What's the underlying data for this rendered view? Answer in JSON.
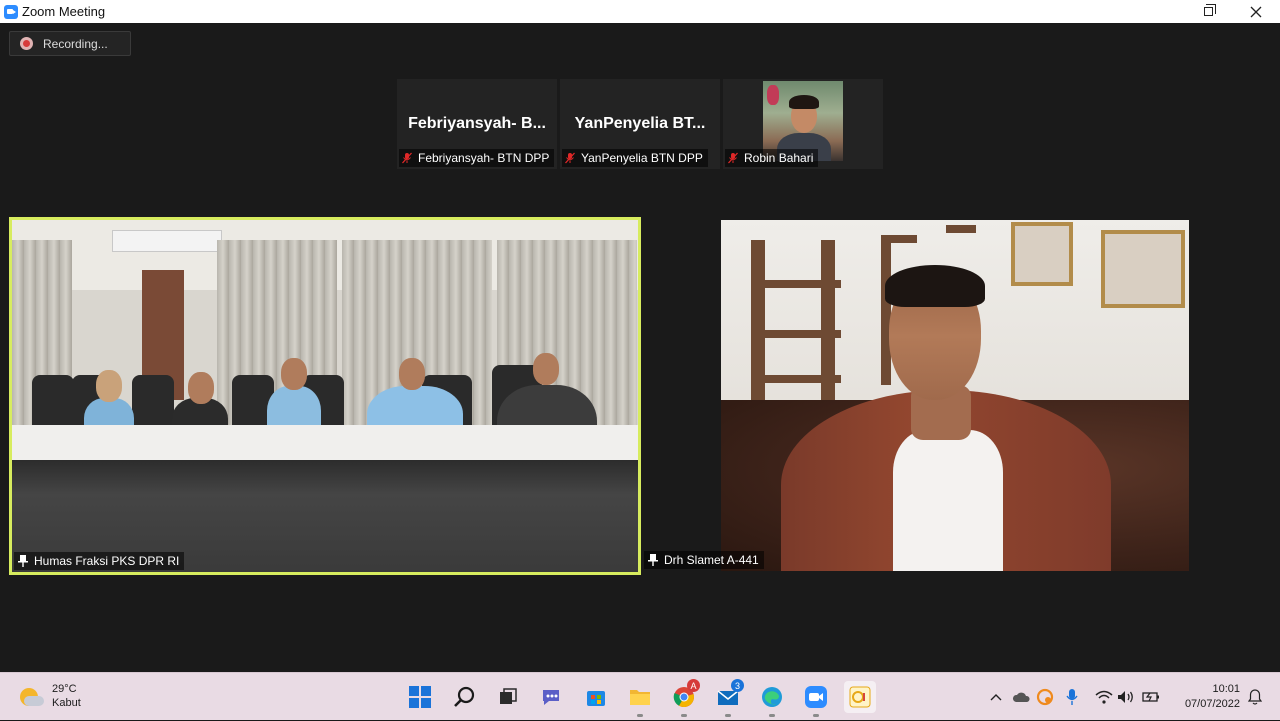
{
  "window": {
    "title": "Zoom Meeting"
  },
  "recording": {
    "label": "Recording..."
  },
  "thumbnails": [
    {
      "display_name": "Febriyansyah-  B...",
      "name_tag": "Febriyansyah- BTN DPP",
      "muted": true,
      "has_video": false
    },
    {
      "display_name": "YanPenyelia  BT...",
      "name_tag": "YanPenyelia BTN DPP",
      "muted": true,
      "has_video": false
    },
    {
      "display_name": "",
      "name_tag": "Robin Bahari",
      "muted": true,
      "has_video": true
    }
  ],
  "main_videos": [
    {
      "name_tag": "Humas Fraksi PKS DPR RI",
      "active_speaker": true
    },
    {
      "name_tag": "Drh Slamet A-441",
      "active_speaker": false
    }
  ],
  "taskbar": {
    "weather": {
      "temp": "29°C",
      "condition": "Kabut"
    },
    "apps": [
      {
        "name": "start",
        "icon": "windows-icon"
      },
      {
        "name": "search",
        "icon": "search-icon"
      },
      {
        "name": "task-view",
        "icon": "task-view-icon"
      },
      {
        "name": "chat",
        "icon": "chat-icon"
      },
      {
        "name": "store",
        "icon": "store-icon"
      },
      {
        "name": "file-explorer",
        "icon": "folder-icon"
      },
      {
        "name": "chrome",
        "icon": "chrome-icon",
        "badge": "A"
      },
      {
        "name": "mail",
        "icon": "mail-icon",
        "badge": "3"
      },
      {
        "name": "edge",
        "icon": "edge-icon"
      },
      {
        "name": "zoom",
        "icon": "zoom-icon"
      },
      {
        "name": "app",
        "icon": "app-icon"
      }
    ],
    "clock": {
      "time": "10:01",
      "date": "07/07/2022"
    }
  },
  "colors": {
    "active_speaker_border": "#d7ec5e",
    "zoom_blue": "#2d8cff",
    "muted_red": "#e02828",
    "taskbar_bg": "#e9dbe4"
  }
}
